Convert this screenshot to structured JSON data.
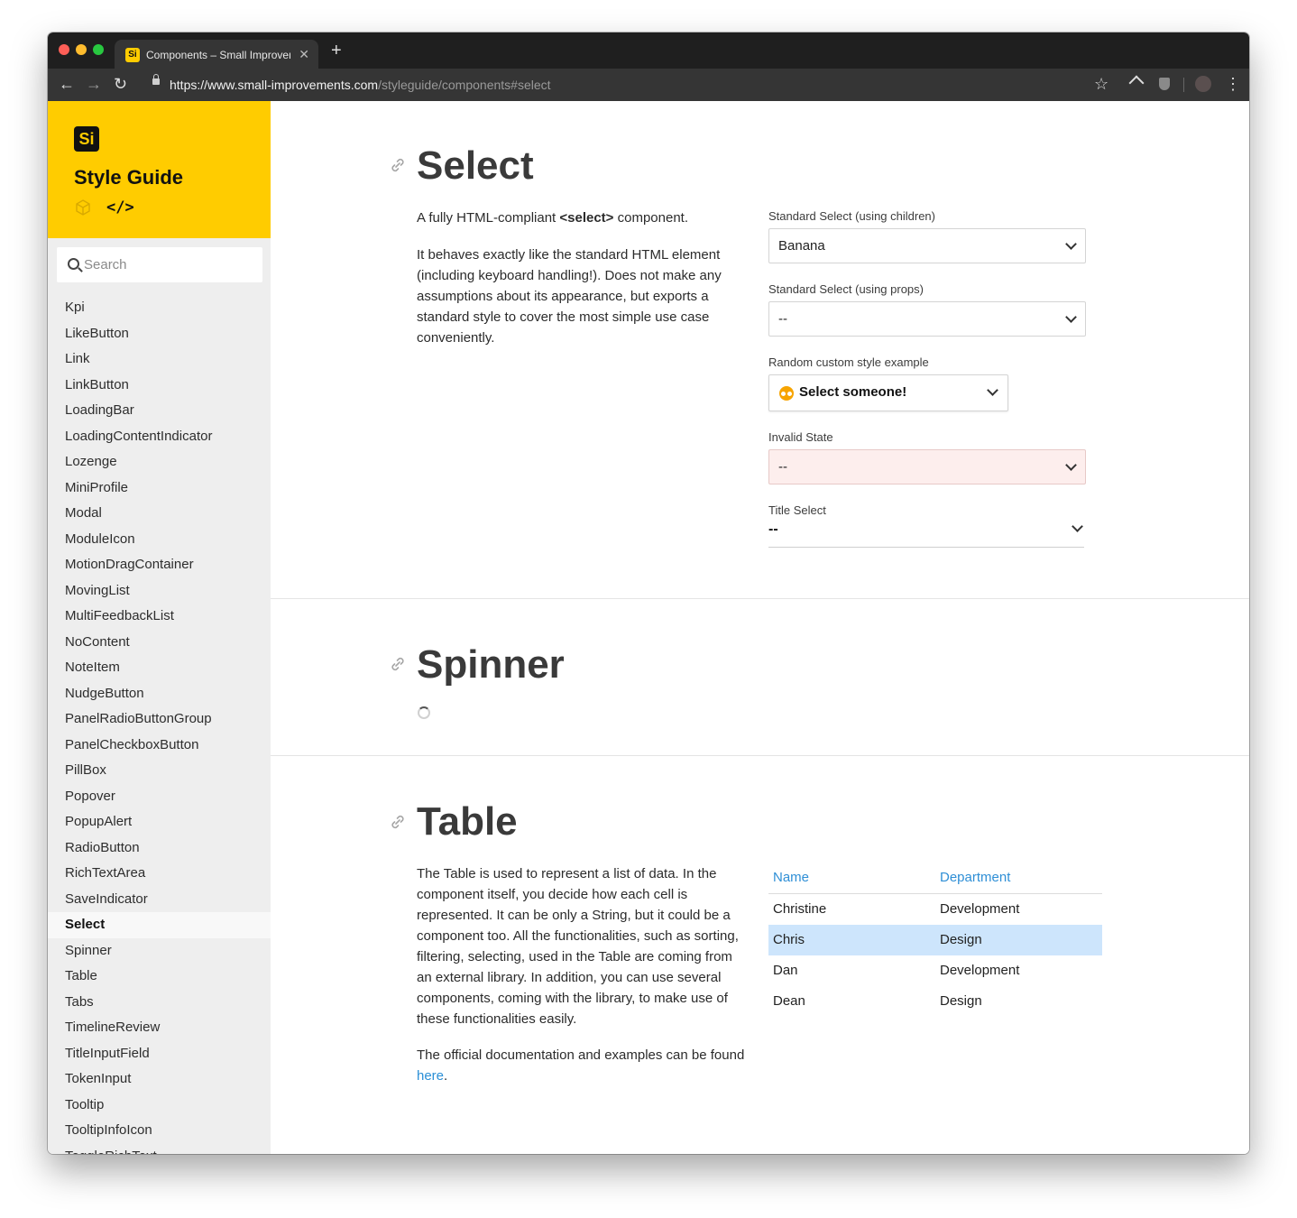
{
  "browser": {
    "tab_title": "Components – Small Improvem",
    "tab_favicon_text": "Si",
    "tab_close": "✕",
    "new_tab": "+",
    "url_host": "https://www.small-improvements.com",
    "url_path": "/styleguide/components#select"
  },
  "sidebar": {
    "logo_text": "Si",
    "title": "Style Guide",
    "code_toggle": "</>",
    "search_placeholder": "Search",
    "items": [
      {
        "label": "Kpi"
      },
      {
        "label": "LikeButton"
      },
      {
        "label": "Link"
      },
      {
        "label": "LinkButton"
      },
      {
        "label": "LoadingBar"
      },
      {
        "label": "LoadingContentIndicator"
      },
      {
        "label": "Lozenge"
      },
      {
        "label": "MiniProfile"
      },
      {
        "label": "Modal"
      },
      {
        "label": "ModuleIcon"
      },
      {
        "label": "MotionDragContainer"
      },
      {
        "label": "MovingList"
      },
      {
        "label": "MultiFeedbackList"
      },
      {
        "label": "NoContent"
      },
      {
        "label": "NoteItem"
      },
      {
        "label": "NudgeButton"
      },
      {
        "label": "PanelRadioButtonGroup"
      },
      {
        "label": "PanelCheckboxButton"
      },
      {
        "label": "PillBox"
      },
      {
        "label": "Popover"
      },
      {
        "label": "PopupAlert"
      },
      {
        "label": "RadioButton"
      },
      {
        "label": "RichTextArea"
      },
      {
        "label": "SaveIndicator"
      },
      {
        "label": "Select",
        "active": true
      },
      {
        "label": "Spinner"
      },
      {
        "label": "Table"
      },
      {
        "label": "Tabs"
      },
      {
        "label": "TimelineReview"
      },
      {
        "label": "TitleInputField"
      },
      {
        "label": "TokenInput"
      },
      {
        "label": "Tooltip"
      },
      {
        "label": "TooltipInfoIcon"
      },
      {
        "label": "ToggleRichText"
      }
    ]
  },
  "select_section": {
    "heading": "Select",
    "intro_prefix": "A fully HTML-compliant ",
    "intro_tag": "<select>",
    "intro_suffix": " component.",
    "description": "It behaves exactly like the standard HTML element (including keyboard handling!). Does not make any assumptions about its appearance, but exports a standard style to cover the most simple use case conveniently.",
    "fields": {
      "children_label": "Standard Select (using children)",
      "children_value": "Banana",
      "props_label": "Standard Select (using props)",
      "props_value": "--",
      "custom_label": "Random custom style example",
      "custom_value": "Select someone!",
      "invalid_label": "Invalid State",
      "invalid_value": "--",
      "title_label": "Title Select",
      "title_value": "--"
    }
  },
  "spinner_section": {
    "heading": "Spinner"
  },
  "table_section": {
    "heading": "Table",
    "description": "The Table is used to represent a list of data. In the component itself, you decide how each cell is represented. It can be only a String, but it could be a component too. All the functionalities, such as sorting, filtering, selecting, used in the Table are coming from an external library. In addition, you can use several components, coming with the library, to make use of these functionalities easily.",
    "docs_prefix": "The official documentation and examples can be found ",
    "docs_link": "here",
    "docs_suffix": ".",
    "columns": [
      "Name",
      "Department"
    ],
    "rows": [
      {
        "name": "Christine",
        "department": "Development",
        "selected": false
      },
      {
        "name": "Chris",
        "department": "Design",
        "selected": true
      },
      {
        "name": "Dan",
        "department": "Development",
        "selected": false
      },
      {
        "name": "Dean",
        "department": "Design",
        "selected": false
      }
    ]
  },
  "colors": {
    "brand_yellow": "#ffcc00",
    "link_blue": "#2a8fd6",
    "selected_row": "#cde5fc",
    "invalid_bg": "#fdeeed"
  }
}
